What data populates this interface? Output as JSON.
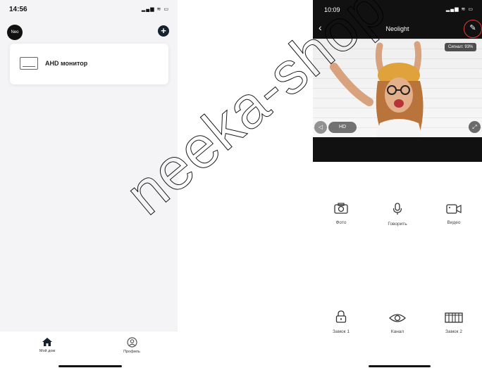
{
  "left_phone": {
    "status": {
      "time": "14:56",
      "icons": "▂▄▆ ≋ ▭"
    },
    "header": {
      "account_badge": "Neo",
      "add_button": "+"
    },
    "device": {
      "name": "AHD монитор"
    },
    "tabs": [
      {
        "label": "Мой дом",
        "icon": "home-icon"
      },
      {
        "label": "Профиль",
        "icon": "profile-icon"
      }
    ]
  },
  "right_phone": {
    "status": {
      "time": "10:09",
      "icons": "▂▄▆ ≋ ▭"
    },
    "header": {
      "title": "Neolight",
      "back": "‹",
      "edit": "✎"
    },
    "video": {
      "signal": "Сигнал: 93%",
      "quality": "HD",
      "mute": "◁",
      "fullscreen": "⤢"
    },
    "controls_row1": [
      {
        "label": "Фото",
        "icon": "camera-icon"
      },
      {
        "label": "Говорить",
        "icon": "microphone-icon"
      },
      {
        "label": "Видео",
        "icon": "video-icon"
      }
    ],
    "controls_row2": [
      {
        "label": "Замок 1",
        "icon": "lock-icon"
      },
      {
        "label": "Канал",
        "icon": "eye-icon"
      },
      {
        "label": "Замок 2",
        "icon": "gate-icon"
      }
    ]
  },
  "watermark": {
    "text": "neeka-shop"
  },
  "colors": {
    "dark": "#111111",
    "accent_red": "#e53935",
    "navy": "#16232f",
    "background": "#f4f4f6"
  }
}
